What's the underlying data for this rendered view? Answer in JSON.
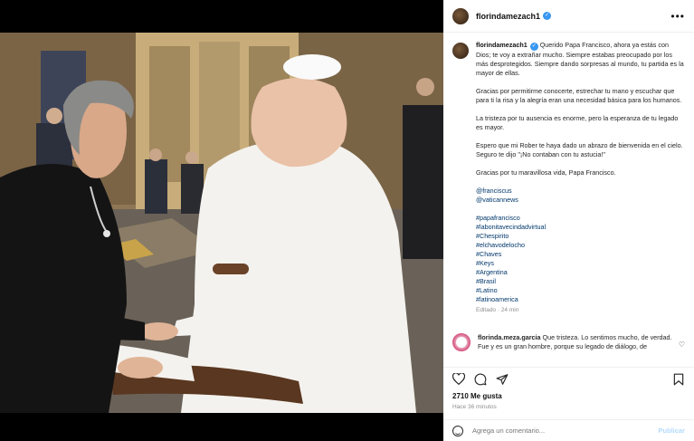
{
  "post": {
    "username": "florindamezach1",
    "caption_p1": "Querido Papa Francisco, ahora ya estás con Dios; te voy a extrañar mucho. Siempre estabas preocupado por los más desprotegidos. Siempre dando sorpresas al mundo, tu partida es la mayor de ellas.",
    "caption_p2": "Gracias por permitirme conocerte, estrechar tu mano y escuchar que para ti la risa y la alegría eran una necesidad básica para los humanos.",
    "caption_p3": "La tristeza por tu ausencia es enorme, pero la esperanza de tu legado es mayor.",
    "caption_p4": "Espero que mi Rober te haya dado un abrazo de bienvenida en el cielo. Seguro te dijo \"¡No contaban con tu astucia!\"",
    "caption_p5": "Gracias por tu maravillosa vida, Papa Francisco.",
    "mentions": [
      "@franciscus",
      "@vaticannews"
    ],
    "hashtags": [
      "#papafrancisco",
      "#labonitavecindadvirtual",
      "#Chespirito",
      "#elchavodelocho",
      "#Chaves",
      "#Keys",
      "#Argentina",
      "#Brasil",
      "#Latino",
      "#latinoamerica"
    ],
    "edited": "Editado · 24 min",
    "likes": "2710 Me gusta",
    "time_ago": "Hace 36 minutos"
  },
  "comment": {
    "username": "florinda.meza.garcia",
    "text": "Que tristeza. Lo sentimos mucho, de verdad.",
    "text2": "Fue y es un gran hombre, porque su legado de diálogo, de"
  },
  "add_comment": {
    "placeholder": "Agrega un comentario...",
    "publish": "Publicar"
  },
  "icons": {
    "verified": "verified-badge-icon",
    "more": "more-options-icon",
    "like": "heart-icon",
    "comment": "comment-icon",
    "share": "share-icon",
    "save": "bookmark-icon",
    "emoji": "emoji-icon"
  }
}
